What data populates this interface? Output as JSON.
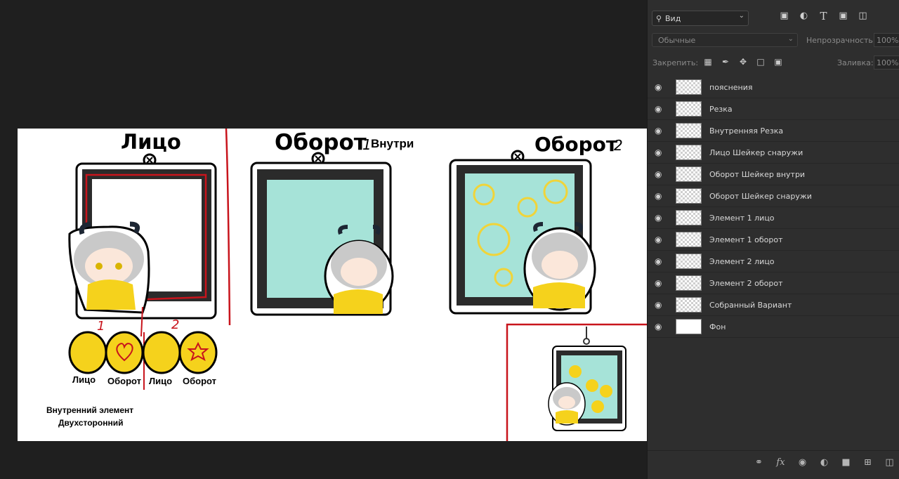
{
  "canvas": {
    "title_face": "Лицо",
    "title_back1": "Оборот",
    "title_back1_num": "1",
    "title_back1_sub": "Внутри",
    "title_back2": "Оборот",
    "title_back2_num": "2",
    "num1": "1",
    "num2": "2",
    "elem1_face": "Лицо",
    "elem1_back": "Оборот",
    "elem2_face": "Лицо",
    "elem2_back": "Оборот",
    "note_line1": "Внутренний элемент",
    "note_line2": "Двухсторонний"
  },
  "layers_panel": {
    "kind_filter": "Вид",
    "filter_icons": [
      "image-filter-icon",
      "adjustment-filter-icon",
      "type-filter-icon",
      "shape-filter-icon",
      "smart-object-filter-icon"
    ],
    "blend_mode": "Обычные",
    "opacity_label": "Непрозрачность:",
    "opacity_value": "100%",
    "lock_label": "Закрепить:",
    "lock_icons": [
      "lock-transparent-icon",
      "lock-paint-icon",
      "lock-position-icon",
      "lock-artboard-icon",
      "lock-all-icon"
    ],
    "fill_label": "Заливка:",
    "fill_value": "100%",
    "layers": [
      {
        "name": "пояснения",
        "visible": true
      },
      {
        "name": "Резка",
        "visible": true
      },
      {
        "name": "Внутренняя Резка",
        "visible": true
      },
      {
        "name": "Лицо Шейкер снаружи",
        "visible": true
      },
      {
        "name": "Оборот Шейкер внутри",
        "visible": true
      },
      {
        "name": "Оборот Шейкер снаружи",
        "visible": true
      },
      {
        "name": "Элемент 1 лицо",
        "visible": true
      },
      {
        "name": "Элемент 1 оборот",
        "visible": true
      },
      {
        "name": "Элемент 2 лицо",
        "visible": true
      },
      {
        "name": "Элемент 2 оборот",
        "visible": true
      },
      {
        "name": "Собранный Вариант",
        "visible": true
      },
      {
        "name": "Фон",
        "visible": true
      }
    ],
    "bottom_icons": [
      "link-layers-icon",
      "fx-icon",
      "layer-mask-icon",
      "adjustment-layer-icon",
      "group-folder-icon",
      "new-layer-icon",
      "trash-icon"
    ]
  },
  "colors": {
    "workspace": "#1f1f1f",
    "panel": "#2e2e2e",
    "shaker_fill": "#a6e3d8",
    "frame_black": "#2b2b2b",
    "cut_red": "#c8141c",
    "sweater_yellow": "#f5d21c"
  }
}
